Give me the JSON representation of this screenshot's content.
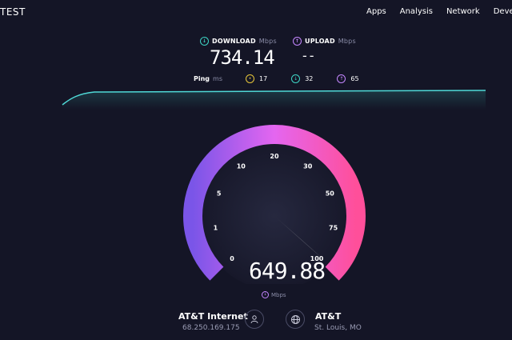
{
  "brand": "TEST",
  "nav": [
    "Apps",
    "Analysis",
    "Network",
    "Develo"
  ],
  "download": {
    "label": "DOWNLOAD",
    "unit": "Mbps",
    "value": "734.14"
  },
  "upload": {
    "label": "UPLOAD",
    "unit": "Mbps",
    "value": "--"
  },
  "ping": {
    "label": "Ping",
    "unit": "ms",
    "idle": "17",
    "download": "32",
    "upload": "65"
  },
  "gauge": {
    "ticks": [
      "0",
      "1",
      "5",
      "10",
      "20",
      "30",
      "50",
      "75",
      "100"
    ],
    "current_value": "649.88",
    "unit": "Mbps",
    "colors": {
      "start": "#7a55e8",
      "middle": "#e466f0",
      "end": "#ff4f9a"
    }
  },
  "client": {
    "isp": "AT&T Internet",
    "ip": "68.250.169.175"
  },
  "server": {
    "name": "AT&T",
    "location": "St. Louis, MO"
  }
}
